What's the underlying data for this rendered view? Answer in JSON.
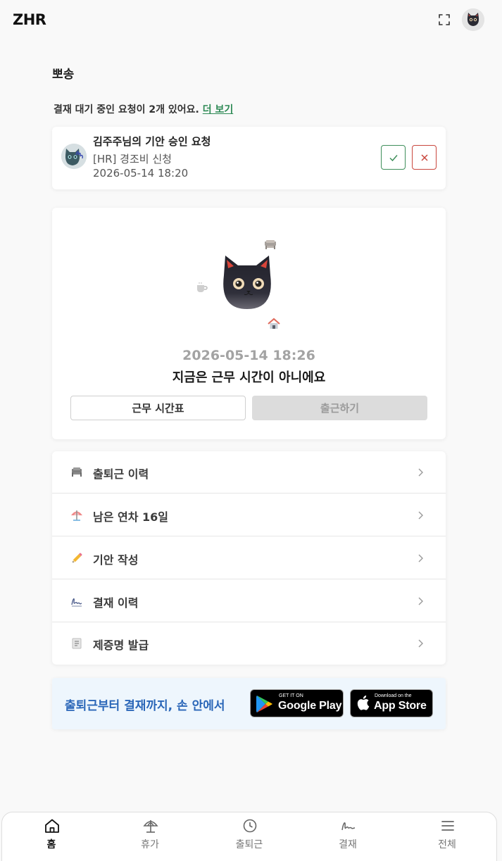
{
  "header": {
    "logo": "ZHR"
  },
  "user": {
    "name": "뽀송"
  },
  "pending": {
    "text": "결재 대기 중인 요청이 2개 있어요.",
    "more_link": "더 보기"
  },
  "approval_request": {
    "title": "김주주님의 기안 승인 요청",
    "subject": "[HR] 경조비 신청",
    "datetime": "2026-05-14 18:20"
  },
  "status": {
    "datetime": "2026-05-14 18:26",
    "message": "지금은 근무 시간이 아니에요",
    "schedule_button": "근무 시간표",
    "checkin_button": "출근하기"
  },
  "menu": [
    {
      "label": "출퇴근 이력",
      "icon": "desk-icon"
    },
    {
      "label": "남은 연차 16일",
      "icon": "parasol-icon"
    },
    {
      "label": "기안 작성",
      "icon": "pencil-icon"
    },
    {
      "label": "결재 이력",
      "icon": "signature-icon"
    },
    {
      "label": "제증명 발급",
      "icon": "document-icon"
    }
  ],
  "promo": {
    "text": "출퇴근부터 결재까지, 손 안에서",
    "google_small": "GET IT ON",
    "google_big": "Google Play",
    "apple_small": "Download on the",
    "apple_big": "App Store"
  },
  "bottom_nav": [
    {
      "label": "홈",
      "icon": "home-icon",
      "active": true
    },
    {
      "label": "휴가",
      "icon": "umbrella-icon",
      "active": false
    },
    {
      "label": "출퇴근",
      "icon": "clock-icon",
      "active": false
    },
    {
      "label": "결재",
      "icon": "signature-icon",
      "active": false
    },
    {
      "label": "전체",
      "icon": "menu-icon",
      "active": false
    }
  ],
  "colors": {
    "approve": "#3f8f5b",
    "reject": "#c9473e",
    "link": "#2e8a55",
    "promo_text": "#2a66b8",
    "background": "#f9f9f9"
  }
}
